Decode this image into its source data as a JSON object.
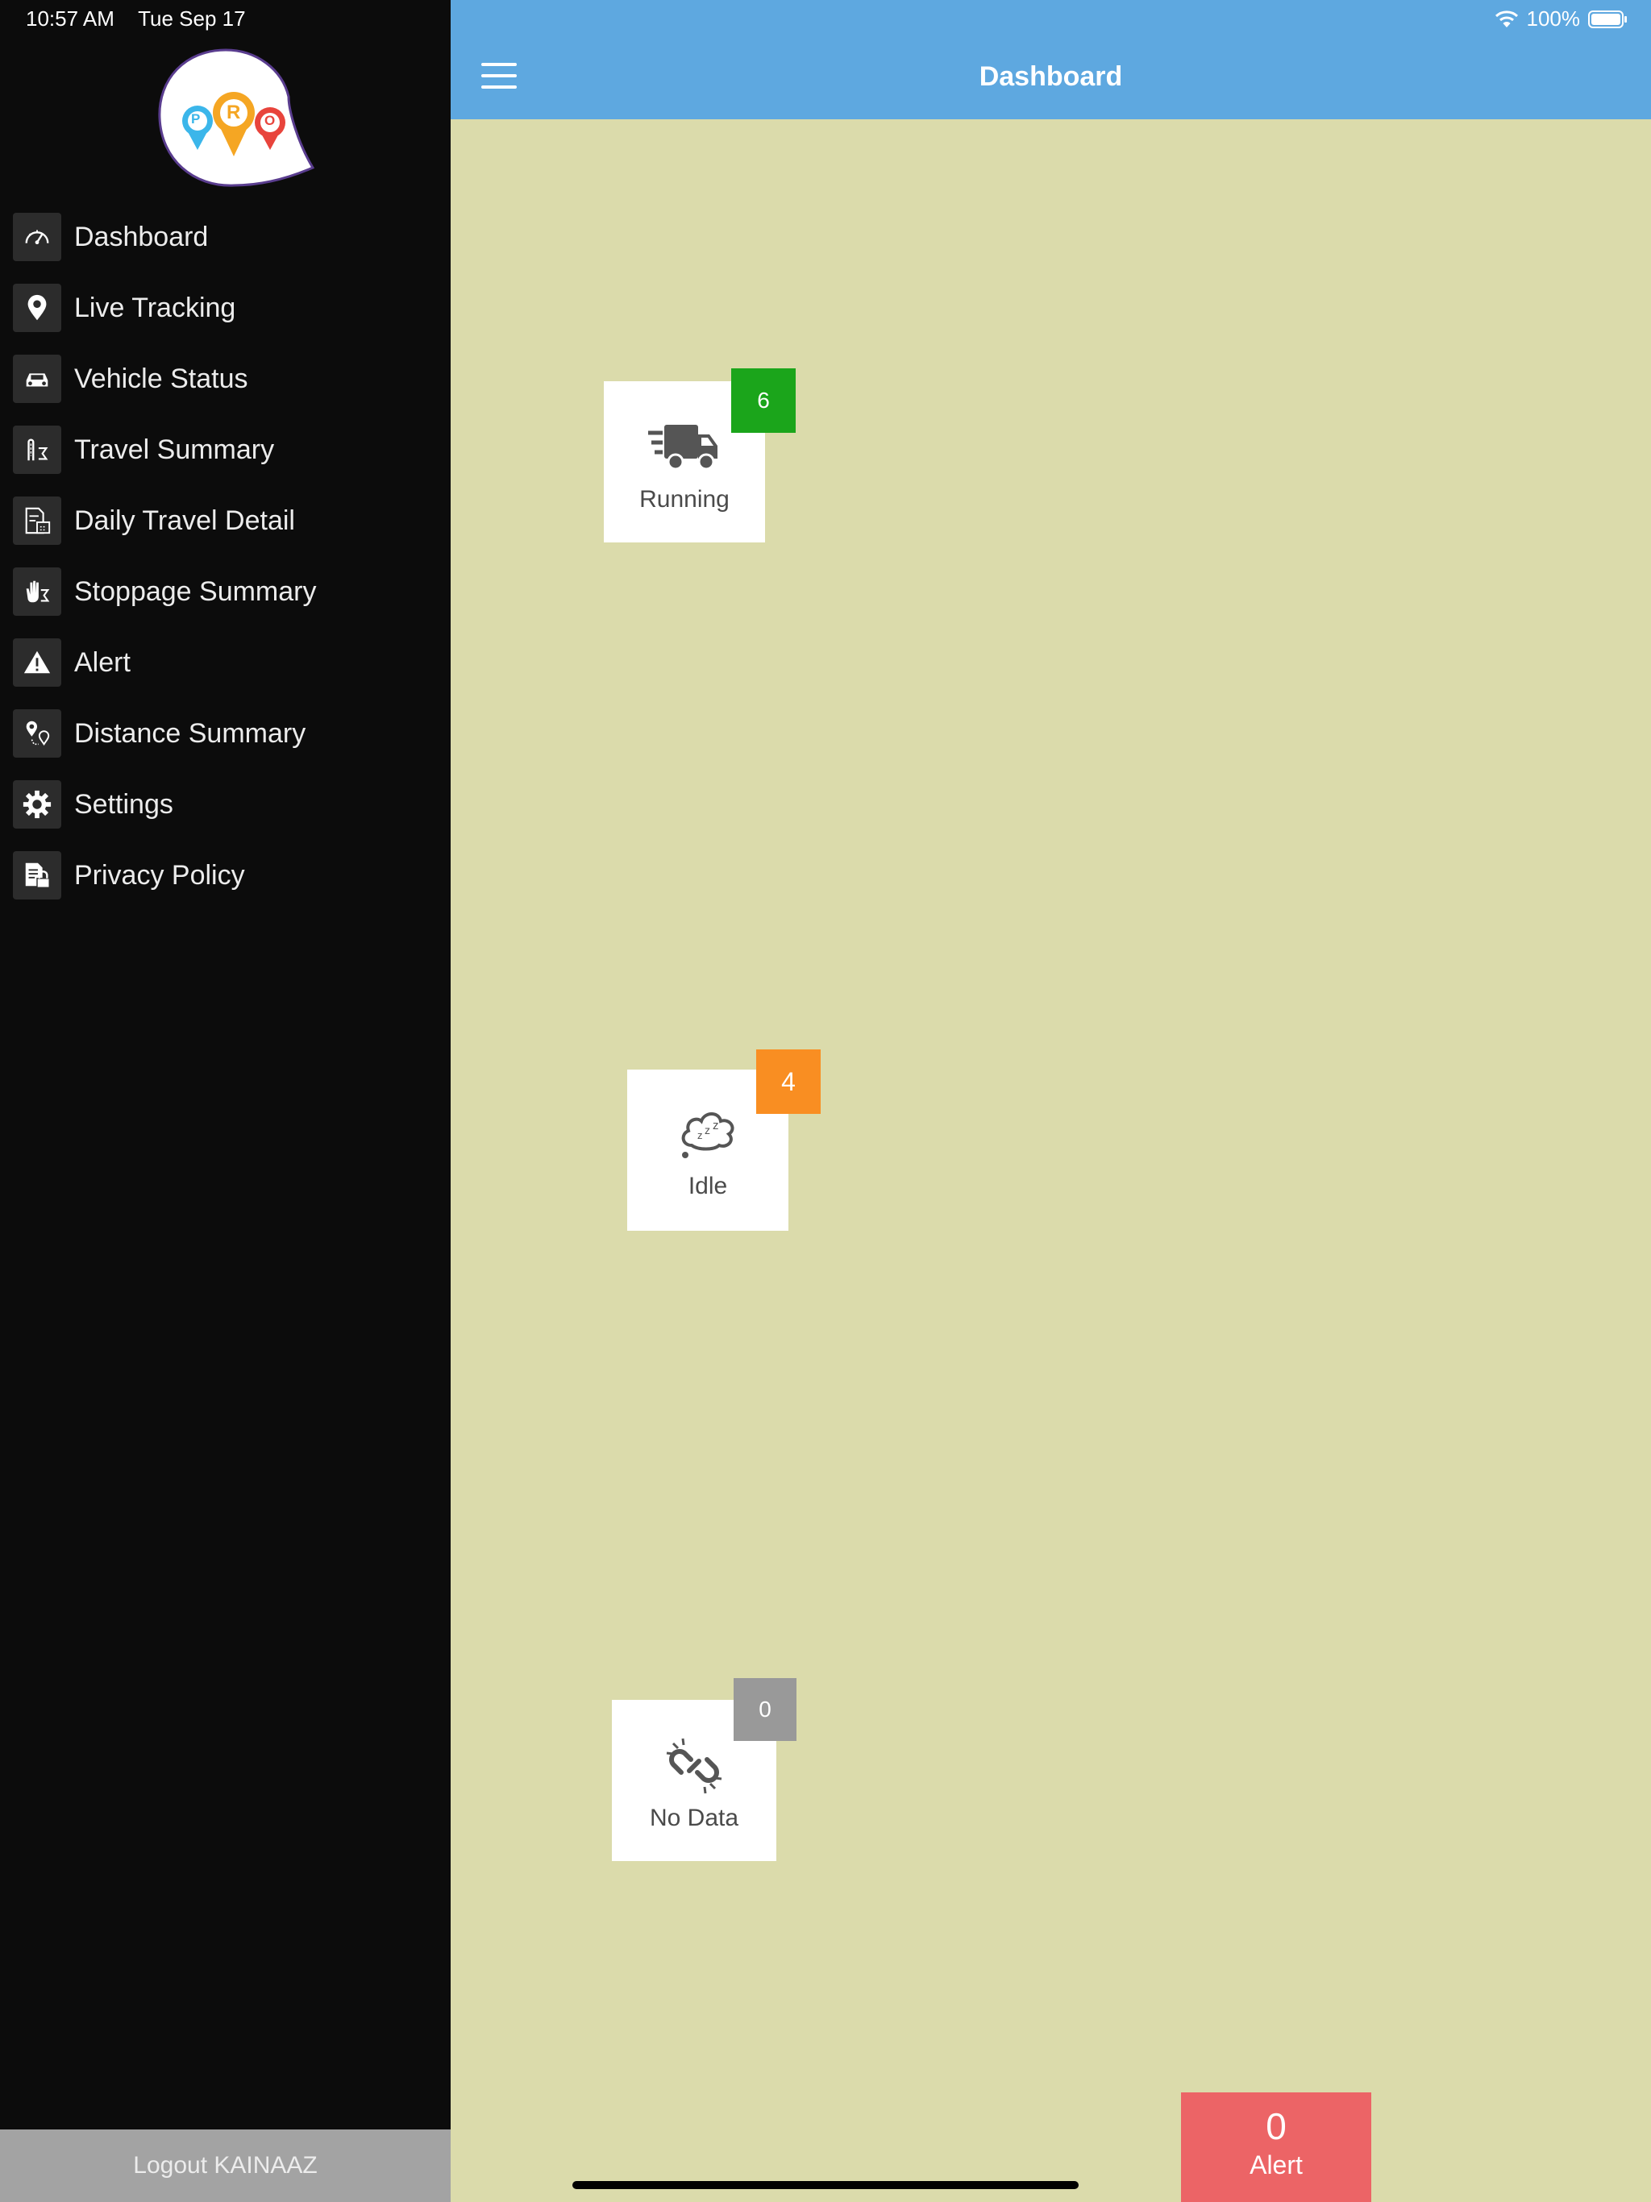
{
  "status_bar": {
    "time": "10:57 AM",
    "date": "Tue Sep 17",
    "battery": "100%",
    "wifi_icon": "wifi-icon",
    "battery_icon": "battery-icon"
  },
  "logo": {
    "letters": [
      "P",
      "R",
      "O"
    ],
    "colors": [
      "#3bb6ea",
      "#f5a623",
      "#e8443c"
    ]
  },
  "sidebar": {
    "items": [
      {
        "label": "Dashboard",
        "icon": "speedometer-icon"
      },
      {
        "label": "Live Tracking",
        "icon": "map-pin-icon"
      },
      {
        "label": "Vehicle Status",
        "icon": "car-icon"
      },
      {
        "label": "Travel Summary",
        "icon": "travel-summary-icon"
      },
      {
        "label": "Daily Travel Detail",
        "icon": "document-calendar-icon"
      },
      {
        "label": "Stoppage Summary",
        "icon": "hand-sigma-icon"
      },
      {
        "label": "Alert",
        "icon": "warning-icon"
      },
      {
        "label": "Distance Summary",
        "icon": "two-pins-icon"
      },
      {
        "label": "Settings",
        "icon": "gear-icon"
      },
      {
        "label": "Privacy Policy",
        "icon": "document-lock-icon"
      }
    ],
    "logout_label": "Logout KAINAAZ"
  },
  "header": {
    "title": "Dashboard",
    "color": "#5ea8e0"
  },
  "cards": [
    {
      "label": "Running",
      "count": "6",
      "badge_color": "#1ba51b",
      "icon": "truck-icon"
    },
    {
      "label": "Idle",
      "count": "4",
      "badge_color": "#f98e22",
      "icon": "sleep-cloud-icon"
    },
    {
      "label": "No Data",
      "count": "0",
      "badge_color": "#999999",
      "icon": "broken-link-icon"
    }
  ],
  "alert": {
    "count": "0",
    "label": "Alert",
    "color": "#ec6466"
  }
}
